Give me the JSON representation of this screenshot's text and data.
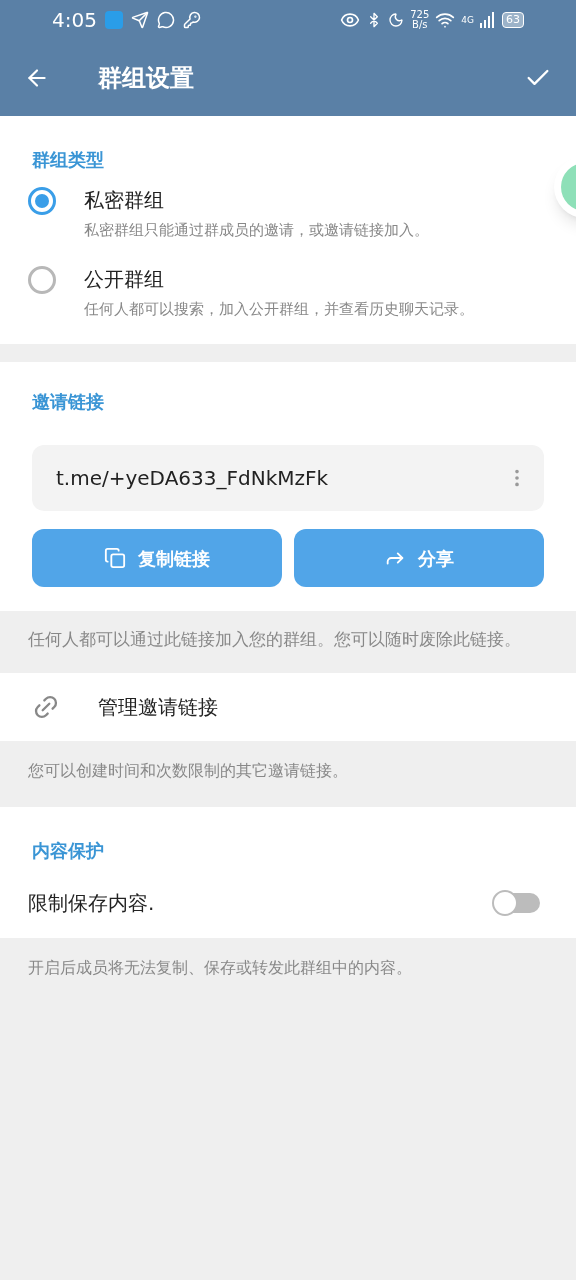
{
  "status_bar": {
    "time": "4:05",
    "speed_value": "725",
    "speed_unit": "B/s",
    "network": "4G",
    "battery": "63"
  },
  "header": {
    "title": "群组设置"
  },
  "group_type": {
    "heading": "群组类型",
    "options": [
      {
        "label": "私密群组",
        "description": "私密群组只能通过群成员的邀请，或邀请链接加入。",
        "selected": true
      },
      {
        "label": "公开群组",
        "description": "任何人都可以搜索，加入公开群组，并查看历史聊天记录。",
        "selected": false
      }
    ]
  },
  "invite_link": {
    "heading": "邀请链接",
    "link": "t.me/+yeDA633_FdNkMzFk",
    "buttons": [
      {
        "kind": "copy",
        "label": "复制链接"
      },
      {
        "kind": "share",
        "label": "分享"
      }
    ],
    "hint": "任何人都可以通过此链接加入您的群组。您可以随时废除此链接。"
  },
  "manage": {
    "label": "管理邀请链接",
    "hint": "您可以创建时间和次数限制的其它邀请链接。"
  },
  "content_protection": {
    "heading": "内容保护",
    "label": "限制保存内容.",
    "on": false,
    "hint": "开启后成员将无法复制、保存或转发此群组中的内容。"
  }
}
